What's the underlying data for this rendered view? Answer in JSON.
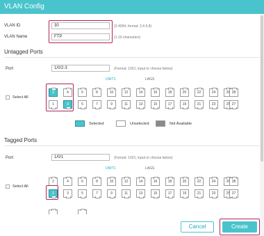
{
  "window": {
    "title": "VLAN Config"
  },
  "vlan_id": {
    "label": "VLAN ID",
    "value": "30",
    "hint": "(2-4094, format: 2,4-5,8)"
  },
  "vlan_name": {
    "label": "VLAN Name",
    "value": "FTP",
    "hint": "(1-16 characters)"
  },
  "untagged": {
    "title": "Untagged Ports",
    "port_label": "Port",
    "port_value": "1/0/2-3",
    "port_hint": "(Format: 1/0/1, input or choose below)",
    "tabs": [
      "UNIT1",
      "LAGS"
    ],
    "select_all": "Select All",
    "top_row": [
      "2",
      "4",
      "6",
      "8",
      "10",
      "12",
      "14",
      "16",
      "18",
      "20",
      "22",
      "24",
      "26",
      "28"
    ],
    "bottom_row": [
      "1",
      "3",
      "5",
      "7",
      "9",
      "11",
      "13",
      "15",
      "17",
      "19",
      "21",
      "23",
      "25",
      "27"
    ],
    "selected": [
      "2",
      "3"
    ]
  },
  "legend": {
    "selected": "Selected",
    "unselected": "Unselected",
    "not_available": "Not Available",
    "colors": {
      "selected": "#4ac4cc",
      "unselected": "#ffffff",
      "not_available": "#8a8a8a"
    }
  },
  "tagged": {
    "title": "Tagged Ports",
    "port_label": "Port",
    "port_value": "1/0/1",
    "port_hint": "(Format: 1/0/1, input or choose below)",
    "tabs": [
      "UNIT1",
      "LAGS"
    ],
    "select_all": "Select All",
    "top_row": [
      "2",
      "4",
      "6",
      "8",
      "10",
      "12",
      "14",
      "16",
      "18",
      "20",
      "22",
      "24",
      "26",
      "28"
    ],
    "bottom_row": [
      "1",
      "3",
      "5",
      "7",
      "9",
      "11",
      "13",
      "15",
      "17",
      "19",
      "21",
      "23",
      "25",
      "27"
    ],
    "selected": [
      "1"
    ]
  },
  "buttons": {
    "cancel": "Cancel",
    "create": "Create"
  },
  "colors": {
    "accent": "#4ac4cc",
    "highlight": "#b0245e"
  }
}
